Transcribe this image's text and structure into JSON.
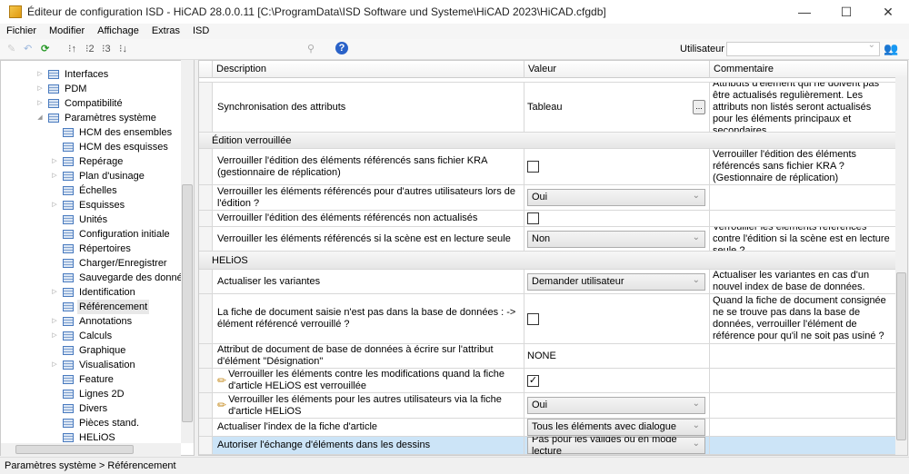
{
  "window": {
    "title": "Éditeur de configuration ISD  - HiCAD 28.0.0.11 [C:\\ProgramData\\ISD Software und Systeme\\HiCAD 2023\\HiCAD.cfgdb]",
    "minimize": "—",
    "maximize": "☐",
    "close": "✕"
  },
  "menu": [
    "Fichier",
    "Modifier",
    "Affichage",
    "Extras",
    "ISD"
  ],
  "toolbar": {
    "user_label": "Utilisateur",
    "user_value": ""
  },
  "tree": [
    {
      "label": "Interfaces",
      "level": 1,
      "expander": "▷"
    },
    {
      "label": "PDM",
      "level": 1,
      "expander": "▷"
    },
    {
      "label": "Compatibilité",
      "level": 1,
      "expander": "▷"
    },
    {
      "label": "Paramètres système",
      "level": 1,
      "expander": "◢"
    },
    {
      "label": "HCM des ensembles",
      "level": 2,
      "expander": ""
    },
    {
      "label": "HCM des esquisses",
      "level": 2,
      "expander": ""
    },
    {
      "label": "Repérage",
      "level": 2,
      "expander": "▷"
    },
    {
      "label": "Plan d'usinage",
      "level": 2,
      "expander": "▷"
    },
    {
      "label": "Échelles",
      "level": 2,
      "expander": ""
    },
    {
      "label": "Esquisses",
      "level": 2,
      "expander": "▷"
    },
    {
      "label": "Unités",
      "level": 2,
      "expander": ""
    },
    {
      "label": "Configuration initiale",
      "level": 2,
      "expander": ""
    },
    {
      "label": "Répertoires",
      "level": 2,
      "expander": ""
    },
    {
      "label": "Charger/Enregistrer",
      "level": 2,
      "expander": ""
    },
    {
      "label": "Sauvegarde des données",
      "level": 2,
      "expander": ""
    },
    {
      "label": "Identification",
      "level": 2,
      "expander": "▷"
    },
    {
      "label": "Référencement",
      "level": 2,
      "expander": "",
      "selected": true
    },
    {
      "label": "Annotations",
      "level": 2,
      "expander": "▷"
    },
    {
      "label": "Calculs",
      "level": 2,
      "expander": "▷"
    },
    {
      "label": "Graphique",
      "level": 2,
      "expander": ""
    },
    {
      "label": "Visualisation",
      "level": 2,
      "expander": "▷"
    },
    {
      "label": "Feature",
      "level": 2,
      "expander": ""
    },
    {
      "label": "Lignes 2D",
      "level": 2,
      "expander": ""
    },
    {
      "label": "Divers",
      "level": 2,
      "expander": ""
    },
    {
      "label": "Pièces stand.",
      "level": 2,
      "expander": ""
    },
    {
      "label": "HELiOS",
      "level": 2,
      "expander": ""
    }
  ],
  "grid": {
    "headers": [
      "Description",
      "Valeur",
      "Commentaire"
    ],
    "rows": [
      {
        "type": "row",
        "desc": "Synchronisation des attributs",
        "kind": "text",
        "value": "Tableau",
        "button": "...",
        "comment": "Attributs d'élément qui ne doivent pas être actualisés regulièrement. Les attributs non listés seront actualisés pour les éléments principaux et secondaires."
      },
      {
        "type": "group",
        "label": "Édition verrouillée"
      },
      {
        "type": "row",
        "desc": "Verrouiller l'édition des éléments référencés sans fichier KRA (gestionnaire de réplication)",
        "kind": "check",
        "checked": false,
        "comment": "Verrouiller l'édition des éléments référencés sans fichier KRA ? (Gestionnaire de réplication)"
      },
      {
        "type": "row",
        "desc": "Verrouiller les éléments référencés pour d'autres utilisateurs lors de l'édition ?",
        "kind": "combo",
        "value": "Oui",
        "comment": ""
      },
      {
        "type": "row",
        "desc": "Verrouiller l'édition des éléments référencés non actualisés",
        "kind": "check",
        "checked": false,
        "comment": ""
      },
      {
        "type": "row",
        "desc": "Verrouiller les éléments référencés si la scène est en lecture seule",
        "kind": "combo",
        "value": "Non",
        "comment": "Verrouiller les éléments référencés contre l'édition si la scène est en lecture seule ?"
      },
      {
        "type": "group",
        "label": "HELiOS"
      },
      {
        "type": "row",
        "desc": "Actualiser les variantes",
        "kind": "combo",
        "value": "Demander utilisateur",
        "comment": "Actualiser les variantes en cas d'un nouvel index de base de données."
      },
      {
        "type": "row",
        "desc": "La fiche de document saisie n'est pas dans la base de données : -> élément référencé verrouillé ?",
        "kind": "check",
        "checked": false,
        "comment": "Quand la fiche de document consignée ne se trouve pas dans la base de données, verrouiller l'élément de référence pour qu'il ne soit pas usiné ?"
      },
      {
        "type": "row",
        "desc": "Attribut de document de base de données à écrire sur l'attribut d'élément \"Désignation\"",
        "kind": "text",
        "value": "NONE",
        "comment": ""
      },
      {
        "type": "row",
        "desc": "Verrouiller les éléments contre les modifications quand la fiche d'article HELiOS est verrouillée",
        "kind": "check",
        "checked": true,
        "modified": true,
        "comment": ""
      },
      {
        "type": "row",
        "desc": "Verrouiller les éléments pour les autres utilisateurs via la fiche d'article HELiOS",
        "kind": "combo",
        "value": "Oui",
        "modified": true,
        "comment": ""
      },
      {
        "type": "row",
        "desc": "Actualiser l'index de la fiche d'article",
        "kind": "combo",
        "value": "Tous les éléments avec dialogue",
        "comment": ""
      },
      {
        "type": "row",
        "desc": "Autoriser l'échange d'éléments dans les dessins",
        "kind": "combo",
        "value": "Pas pour les validés ou en mode lecture",
        "comment": "",
        "selected": true
      }
    ]
  },
  "status": "Paramètres système > Référencement"
}
